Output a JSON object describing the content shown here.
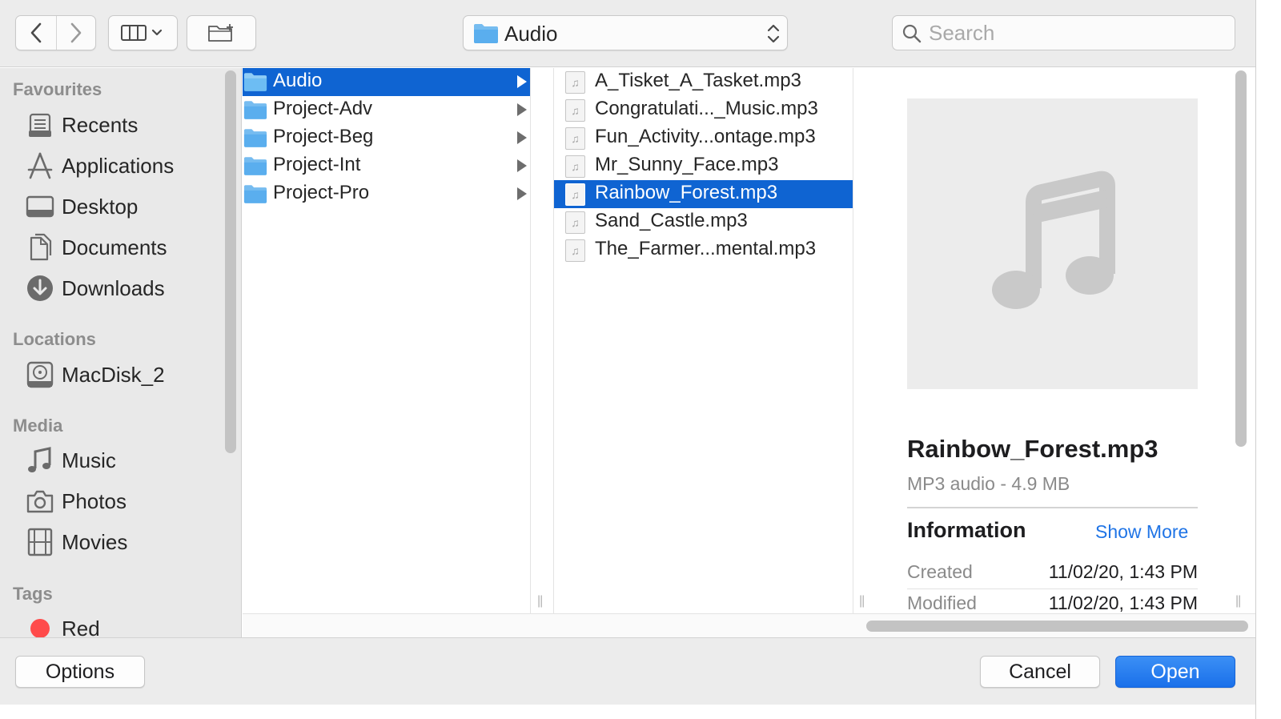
{
  "toolbar": {
    "back_icon": "chevron-left-icon",
    "forward_icon": "chevron-right-icon",
    "view_icon": "column-view-icon",
    "new_folder_icon": "new-folder-icon",
    "path_label": "Audio",
    "search_placeholder": "Search"
  },
  "sidebar": {
    "sections": [
      {
        "title": "Favourites",
        "items": [
          {
            "label": "Recents",
            "icon": "recents-icon"
          },
          {
            "label": "Applications",
            "icon": "applications-icon"
          },
          {
            "label": "Desktop",
            "icon": "desktop-icon"
          },
          {
            "label": "Documents",
            "icon": "documents-icon"
          },
          {
            "label": "Downloads",
            "icon": "downloads-icon"
          }
        ]
      },
      {
        "title": "Locations",
        "items": [
          {
            "label": "MacDisk_2",
            "icon": "disk-icon"
          }
        ]
      },
      {
        "title": "Media",
        "items": [
          {
            "label": "Music",
            "icon": "music-icon"
          },
          {
            "label": "Photos",
            "icon": "camera-icon"
          },
          {
            "label": "Movies",
            "icon": "film-icon"
          }
        ]
      },
      {
        "title": "Tags",
        "items": [
          {
            "label": "Red",
            "icon": "red-tag-icon",
            "color": "#ff4b4b"
          }
        ]
      }
    ]
  },
  "columns": {
    "folders": [
      {
        "name": "Audio",
        "selected": true
      },
      {
        "name": "Project-Adv",
        "selected": false
      },
      {
        "name": "Project-Beg",
        "selected": false
      },
      {
        "name": "Project-Int",
        "selected": false
      },
      {
        "name": "Project-Pro",
        "selected": false
      }
    ],
    "files": [
      {
        "name": "A_Tisket_A_Tasket.mp3",
        "selected": false
      },
      {
        "name": "Congratulati..._Music.mp3",
        "selected": false
      },
      {
        "name": "Fun_Activity...ontage.mp3",
        "selected": false
      },
      {
        "name": "Mr_Sunny_Face.mp3",
        "selected": false
      },
      {
        "name": "Rainbow_Forest.mp3",
        "selected": true
      },
      {
        "name": "Sand_Castle.mp3",
        "selected": false
      },
      {
        "name": "The_Farmer...mental.mp3",
        "selected": false
      }
    ]
  },
  "preview": {
    "name": "Rainbow_Forest.mp3",
    "kind": "MP3 audio - 4.9 MB",
    "info_heading": "Information",
    "show_more": "Show More",
    "rows": [
      {
        "label": "Created",
        "value": "11/02/20, 1:43 PM"
      },
      {
        "label": "Modified",
        "value": "11/02/20, 1:43 PM"
      }
    ]
  },
  "footer": {
    "options_label": "Options",
    "cancel_label": "Cancel",
    "open_label": "Open"
  },
  "colors": {
    "selection": "#0f64d2",
    "accent_link": "#1f74e6",
    "primary_button": "#1a70ea"
  }
}
